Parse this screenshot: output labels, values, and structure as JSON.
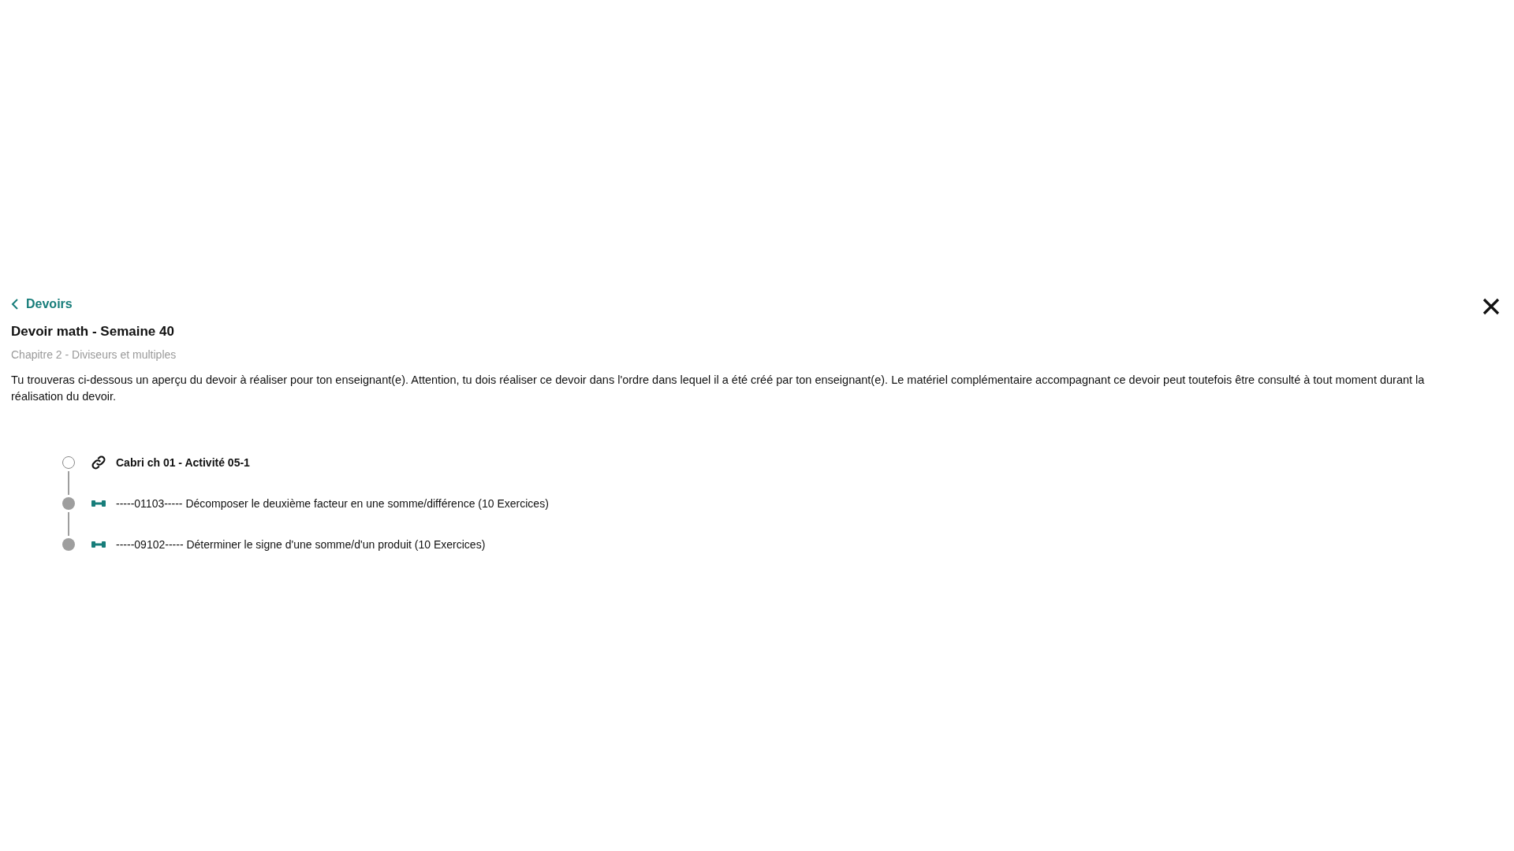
{
  "back_link": {
    "label": "Devoirs"
  },
  "title": "Devoir math - Semaine 40",
  "subtitle": "Chapitre 2 - Diviseurs et multiples",
  "description": "Tu trouveras ci-dessous un aperçu du devoir à réaliser pour ton enseignant(e). Attention, tu dois réaliser ce devoir dans l'ordre dans lequel il a été créé par ton enseignant(e). Le matériel complémentaire accompagnant ce devoir peut toutefois être consulté à tout moment durant la réalisation du devoir.",
  "items": [
    {
      "kind": "link",
      "label": "Cabri ch 01 - Activité 05-1"
    },
    {
      "kind": "exercise",
      "label": "-----01103----- Décomposer le deuxième facteur en une somme/différence (10 Exercices)"
    },
    {
      "kind": "exercise",
      "label": "-----09102----- Déterminer le signe d'une somme/d'un produit (10 Exercices)"
    }
  ]
}
